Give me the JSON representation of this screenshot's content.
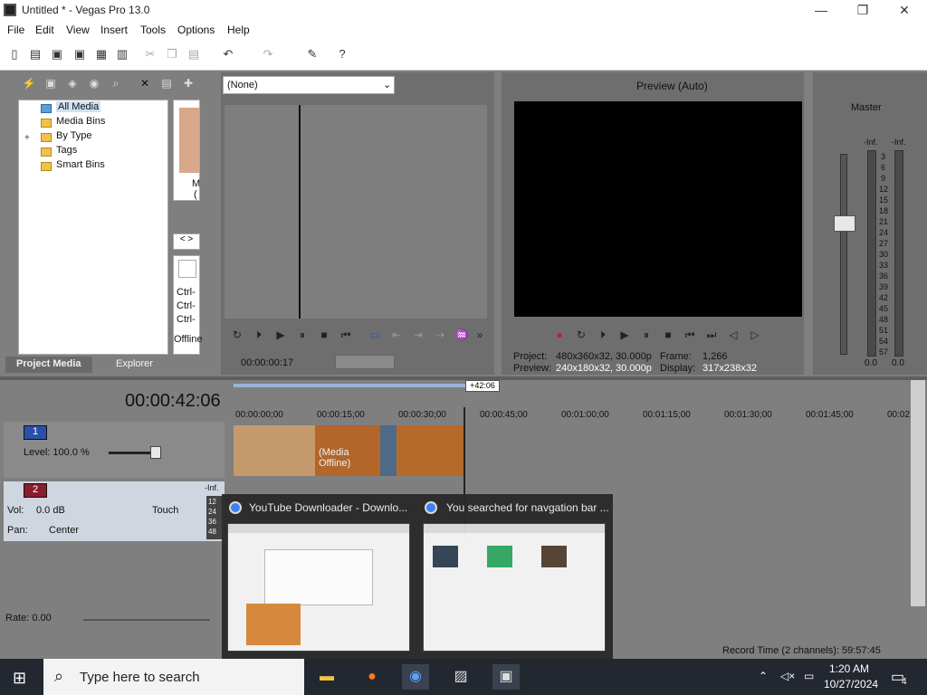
{
  "window": {
    "title": "Untitled * - Vegas Pro 13.0",
    "min": "—",
    "max": "❐",
    "close": "✕"
  },
  "menu": [
    "File",
    "Edit",
    "View",
    "Insert",
    "Tools",
    "Options",
    "Help"
  ],
  "media_panel": {
    "tree": [
      "All Media",
      "Media Bins",
      "By Type",
      "Tags",
      "Smart Bins"
    ],
    "expander": "+",
    "tabs": [
      "Project Media",
      "Explorer"
    ],
    "nav": "< >",
    "item_labels": [
      "M",
      "(",
      "Ctrl-",
      "Ctrl-",
      "Ctrl-",
      "Offline"
    ]
  },
  "trimmer": {
    "dropdown_value": "(None)",
    "timecode": "00:00:00:17"
  },
  "preview": {
    "mode": "Preview (Auto)",
    "project_label": "Project:",
    "project_value": "480x360x32, 30.000p",
    "frame_label": "Frame:",
    "frame_value": "1,266",
    "preview_label": "Preview:",
    "preview_value": "240x180x32, 30.000p",
    "display_label": "Display:",
    "display_value": "317x238x32"
  },
  "mixer": {
    "title": "Master",
    "left_inf": "-Inf.",
    "right_inf": "-Inf.",
    "scale": [
      "3",
      "6",
      "9",
      "12",
      "15",
      "18",
      "21",
      "24",
      "27",
      "30",
      "33",
      "36",
      "39",
      "42",
      "45",
      "48",
      "51",
      "54",
      "57"
    ],
    "left_val": "0.0",
    "right_val": "0.0"
  },
  "timeline": {
    "timecode": "00:00:42:06",
    "marker": "+42:06",
    "ruler": [
      "00:00:00;00",
      "00:00:15;00",
      "00:00:30;00",
      "00:00:45;00",
      "00:01:00;00",
      "00:01:15;00",
      "00:01:30;00",
      "00:01:45;00",
      "00:02"
    ],
    "track1": {
      "num": "1",
      "level": "Level: 100.0 %"
    },
    "track2": {
      "num": "2",
      "vol": "Vol:",
      "vol_value": "0.0 dB",
      "pan": "Pan:",
      "pan_value": "Center",
      "touch": "Touch",
      "inf": "-Inf.",
      "meter_scale": [
        "12",
        "24",
        "36",
        "48"
      ]
    },
    "clip_offline": "(Media Offline)",
    "rate": "Rate: 0.00",
    "record_time": "Record Time (2 channels): 59:57:45"
  },
  "thumbnails": [
    {
      "title": "YouTube Downloader - Downlo..."
    },
    {
      "title": "You searched for navgation bar ..."
    }
  ],
  "taskbar": {
    "search_placeholder": "Type here to search",
    "time": "1:20 AM",
    "date": "10/27/2024",
    "notif_count": "4"
  }
}
